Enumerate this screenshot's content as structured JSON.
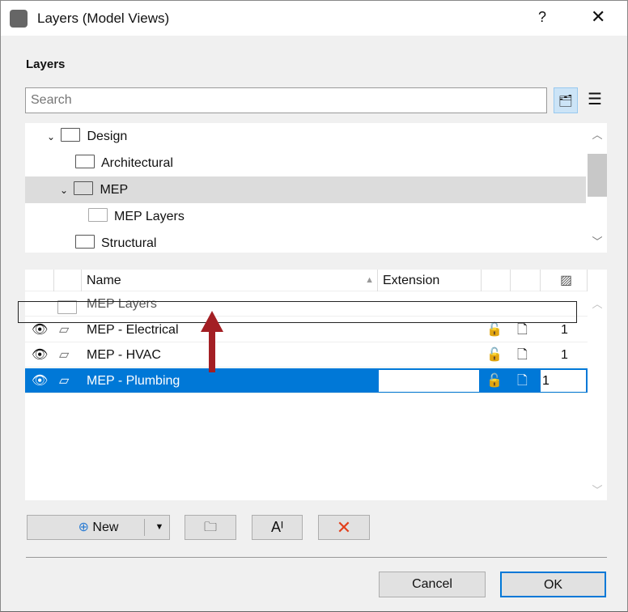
{
  "window": {
    "title": "Layers (Model Views)",
    "help": "?",
    "close": "✕"
  },
  "section_title": "Layers",
  "search": {
    "placeholder": "Search",
    "value": ""
  },
  "tree": [
    {
      "label": "Design",
      "expanded": true,
      "level": 0
    },
    {
      "label": "Architectural",
      "level": 1
    },
    {
      "label": "MEP",
      "expanded": true,
      "level": 1,
      "selected": true
    },
    {
      "label": "MEP Layers",
      "level": 2
    },
    {
      "label": "Structural",
      "level": 1
    }
  ],
  "list": {
    "headers": {
      "name": "Name",
      "extension": "Extension"
    },
    "ghost_row": "MEP Layers",
    "rows": [
      {
        "name": "MEP - Electrical",
        "extension": "",
        "number": "1"
      },
      {
        "name": "MEP - HVAC",
        "extension": "",
        "number": "1"
      },
      {
        "name": "MEP - Plumbing",
        "extension": "",
        "number": "1",
        "selected": true
      }
    ]
  },
  "buttons": {
    "new": "New",
    "cancel": "Cancel",
    "ok": "OK"
  },
  "colors": {
    "selection": "#0078d7",
    "arrow": "#a31f24",
    "delete": "#e2401c"
  }
}
